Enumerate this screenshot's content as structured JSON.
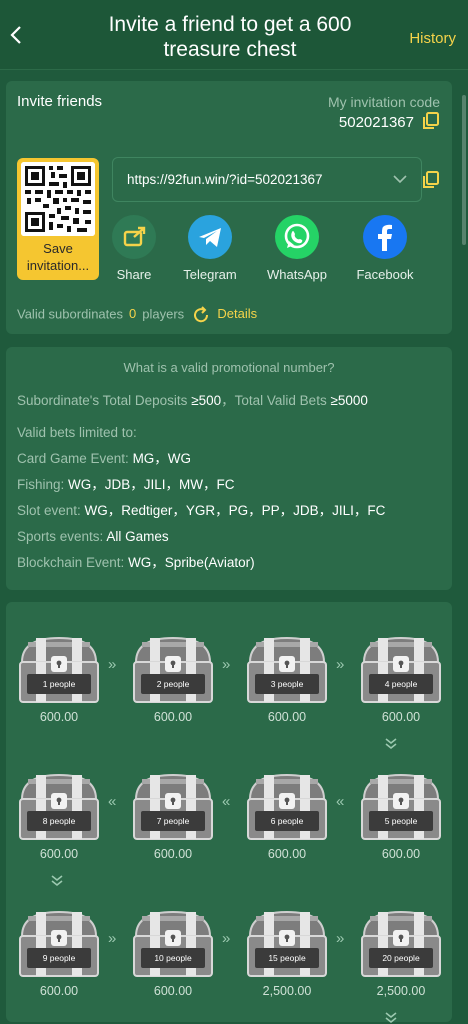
{
  "header": {
    "title": "Invite a friend to get a 600 treasure chest",
    "history": "History"
  },
  "invite": {
    "title": "Invite friends",
    "code_label": "My invitation code",
    "code": "502021367",
    "link": "https://92fun.win/?id=502021367",
    "save_label": "Save invitation...",
    "share": [
      {
        "label": "Share",
        "icon": "share-icon",
        "color": "#2f7a55"
      },
      {
        "label": "Telegram",
        "icon": "telegram-icon",
        "color": "#2aa3de"
      },
      {
        "label": "WhatsApp",
        "icon": "whatsapp-icon",
        "color": "#25d366"
      },
      {
        "label": "Facebook",
        "icon": "facebook-icon",
        "color": "#1877f2"
      }
    ],
    "valid_label": "Valid subordinates",
    "valid_count": "0",
    "valid_unit": "players",
    "details": "Details"
  },
  "rules": {
    "question": "What is a valid promotional number?",
    "deposit_label": "Subordinate's Total Deposits",
    "deposit_value": "≥500",
    "bets_label": "，Total Valid Bets",
    "bets_value": "≥5000",
    "limited": "Valid bets limited to:",
    "items": [
      {
        "label": "Card Game Event: ",
        "value": "MG，WG"
      },
      {
        "label": "Fishing: ",
        "value": "WG，JDB，JILI，MW，FC"
      },
      {
        "label": "Slot event: ",
        "value": "WG，Redtiger，YGR，PG，PP，JDB，JILI，FC"
      },
      {
        "label": "Sports events: ",
        "value": "All Games"
      },
      {
        "label": "Blockchain Event: ",
        "value": "WG，Spribe(Aviator)"
      }
    ]
  },
  "chests": [
    {
      "people": "1 people",
      "amount": "600.00"
    },
    {
      "people": "2 people",
      "amount": "600.00"
    },
    {
      "people": "3 people",
      "amount": "600.00"
    },
    {
      "people": "4 people",
      "amount": "600.00"
    },
    {
      "people": "5 people",
      "amount": "600.00"
    },
    {
      "people": "6 people",
      "amount": "600.00"
    },
    {
      "people": "7 people",
      "amount": "600.00"
    },
    {
      "people": "8 people",
      "amount": "600.00"
    },
    {
      "people": "9 people",
      "amount": "600.00"
    },
    {
      "people": "10 people",
      "amount": "600.00"
    },
    {
      "people": "15 people",
      "amount": "2,500.00"
    },
    {
      "people": "20 people",
      "amount": "2,500.00"
    }
  ],
  "colors": {
    "bg": "#1f5a3c",
    "card": "#2b6a49",
    "accent": "#f5d34a"
  }
}
